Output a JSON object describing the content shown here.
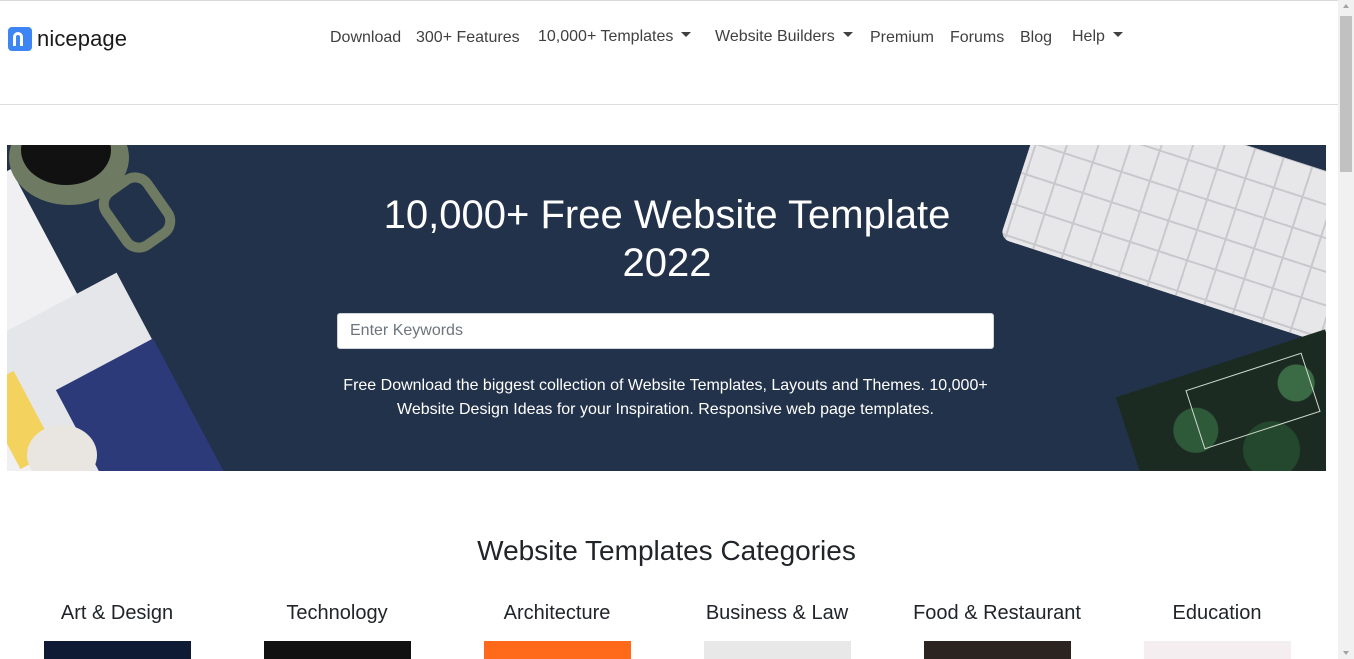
{
  "header": {
    "logo_text": "nicepage",
    "nav": [
      {
        "label": "Download",
        "dropdown": false
      },
      {
        "label": "300+ Features",
        "dropdown": false
      },
      {
        "label": "10,000+ Templates",
        "dropdown": true
      },
      {
        "label": "Website Builders",
        "dropdown": true
      },
      {
        "label": "Premium",
        "dropdown": false
      },
      {
        "label": "Forums",
        "dropdown": false
      },
      {
        "label": "Blog",
        "dropdown": false
      },
      {
        "label": "Help",
        "dropdown": true
      }
    ]
  },
  "hero": {
    "title_line1": "10,000+ Free Website Template",
    "title_line2": "2022",
    "search_placeholder": "Enter Keywords",
    "description": "Free Download the biggest collection of Website Templates, Layouts and Themes. 10,000+ Website Design Ideas for your Inspiration. Responsive web page templates.",
    "background_color": "#22324a"
  },
  "categories": {
    "title": "Website Templates Categories",
    "items": [
      {
        "label": "Art & Design",
        "thumb_color": "#0f1a35"
      },
      {
        "label": "Technology",
        "thumb_color": "#111111"
      },
      {
        "label": "Architecture",
        "thumb_color": "#ff6a1a"
      },
      {
        "label": "Business & Law",
        "thumb_color": "#e8e8e8"
      },
      {
        "label": "Food & Restaurant",
        "thumb_color": "#2b2420"
      },
      {
        "label": "Education",
        "thumb_color": "#f5eef0"
      }
    ]
  },
  "colors": {
    "brand": "#3d84f5",
    "text": "#212529"
  }
}
